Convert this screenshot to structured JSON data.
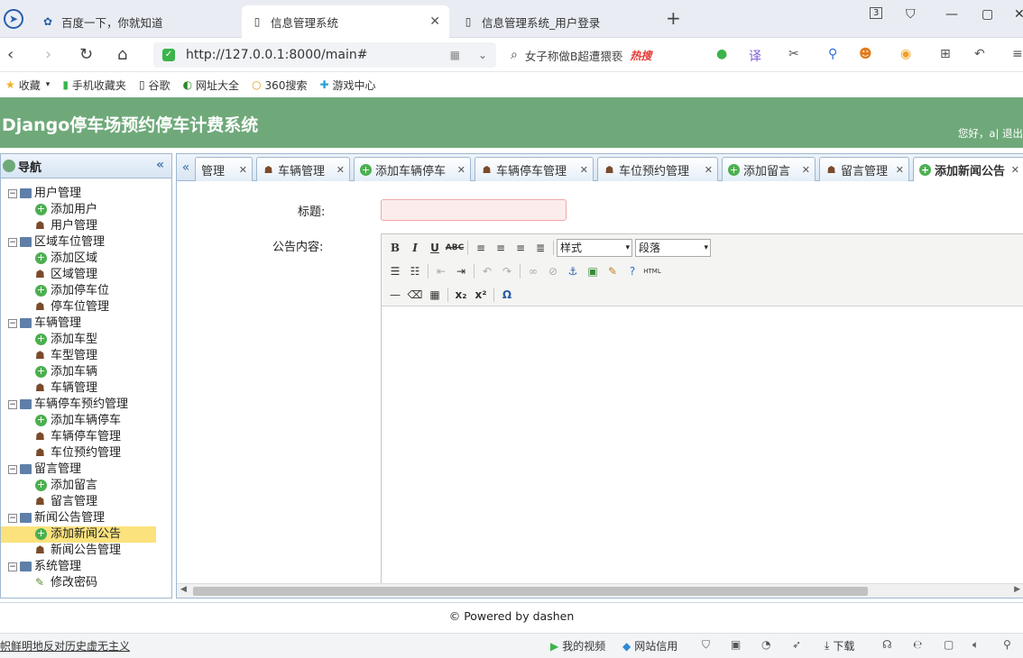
{
  "browser": {
    "tabs": [
      {
        "label": "百度一下，你就知道"
      },
      {
        "label": "信息管理系统"
      },
      {
        "label": "信息管理系统_用户登录"
      }
    ],
    "tab_counter": "3",
    "url": "http://127.0.0.1:8000/main#",
    "search_text": "女子称做B超遭猥亵",
    "search_hot": "热搜",
    "bookmarks": [
      "收藏",
      "手机收藏夹",
      "谷歌",
      "网址大全",
      "360搜索",
      "游戏中心"
    ]
  },
  "app": {
    "title": "Django停车场预约停车计费系统",
    "user_text": "您好，a| 退出"
  },
  "sidebar": {
    "title": "导航",
    "groups": [
      {
        "label": "用户管理",
        "items": [
          {
            "label": "添加用户",
            "icon": "add"
          },
          {
            "label": "用户管理",
            "icon": "user"
          }
        ]
      },
      {
        "label": "区域车位管理",
        "items": [
          {
            "label": "添加区域",
            "icon": "add"
          },
          {
            "label": "区域管理",
            "icon": "user"
          },
          {
            "label": "添加停车位",
            "icon": "add"
          },
          {
            "label": "停车位管理",
            "icon": "user"
          }
        ]
      },
      {
        "label": "车辆管理",
        "items": [
          {
            "label": "添加车型",
            "icon": "add"
          },
          {
            "label": "车型管理",
            "icon": "user"
          },
          {
            "label": "添加车辆",
            "icon": "add"
          },
          {
            "label": "车辆管理",
            "icon": "user"
          }
        ]
      },
      {
        "label": "车辆停车预约管理",
        "items": [
          {
            "label": "添加车辆停车",
            "icon": "add"
          },
          {
            "label": "车辆停车管理",
            "icon": "user"
          },
          {
            "label": "车位预约管理",
            "icon": "user"
          }
        ]
      },
      {
        "label": "留言管理",
        "items": [
          {
            "label": "添加留言",
            "icon": "add"
          },
          {
            "label": "留言管理",
            "icon": "user"
          }
        ]
      },
      {
        "label": "新闻公告管理",
        "items": [
          {
            "label": "添加新闻公告",
            "icon": "add",
            "selected": true
          },
          {
            "label": "新闻公告管理",
            "icon": "user"
          }
        ]
      },
      {
        "label": "系统管理",
        "items": [
          {
            "label": "修改密码",
            "icon": "pen"
          }
        ]
      }
    ]
  },
  "main_tabs": [
    {
      "label": "管理",
      "icon": "none"
    },
    {
      "label": "车辆管理",
      "icon": "user"
    },
    {
      "label": "添加车辆停车",
      "icon": "add"
    },
    {
      "label": "车辆停车管理",
      "icon": "user"
    },
    {
      "label": "车位预约管理",
      "icon": "user"
    },
    {
      "label": "添加留言",
      "icon": "add"
    },
    {
      "label": "留言管理",
      "icon": "user"
    },
    {
      "label": "添加新闻公告",
      "icon": "add",
      "active": true
    }
  ],
  "form": {
    "title_label": "标题:",
    "title_value": "",
    "content_label": "公告内容:",
    "style_select": "样式",
    "paragraph_select": "段落"
  },
  "footer": "© Powered by dashen",
  "status": {
    "left_text": "帜鲜明地反对历史虚无主义",
    "video": "我的视频",
    "credit": "网站信用",
    "download": "下载"
  }
}
